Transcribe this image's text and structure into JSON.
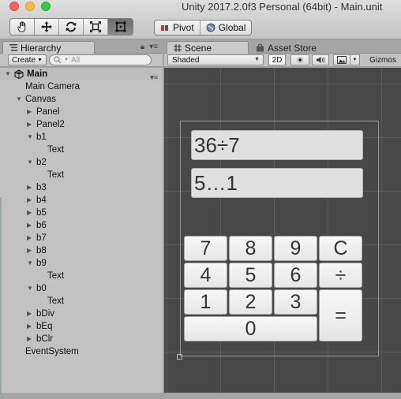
{
  "window": {
    "title": "Unity 2017.2.0f3 Personal (64bit) - Main.unit"
  },
  "toolbar": {
    "tools": [
      {
        "name": "hand-tool",
        "icon": "hand-icon"
      },
      {
        "name": "move-tool",
        "icon": "move-arrows-icon"
      },
      {
        "name": "rotate-tool",
        "icon": "rotate-icon"
      },
      {
        "name": "scale-tool",
        "icon": "scale-icon"
      },
      {
        "name": "rect-tool",
        "icon": "rect-transform-icon",
        "active": true
      }
    ],
    "pivot_label": "Pivot",
    "global_label": "Global"
  },
  "hierarchy": {
    "tab_label": "Hierarchy",
    "create_label": "Create",
    "search_placeholder": "All",
    "scene_name": "Main",
    "items": [
      {
        "label": "Main Camera",
        "depth": 1,
        "arrow": ""
      },
      {
        "label": "Canvas",
        "depth": 1,
        "arrow": "down"
      },
      {
        "label": "Panel",
        "depth": 2,
        "arrow": "right"
      },
      {
        "label": "Panel2",
        "depth": 2,
        "arrow": "right"
      },
      {
        "label": "b1",
        "depth": 2,
        "arrow": "down"
      },
      {
        "label": "Text",
        "depth": 3,
        "arrow": ""
      },
      {
        "label": "b2",
        "depth": 2,
        "arrow": "down"
      },
      {
        "label": "Text",
        "depth": 3,
        "arrow": ""
      },
      {
        "label": "b3",
        "depth": 2,
        "arrow": "right"
      },
      {
        "label": "b4",
        "depth": 2,
        "arrow": "right"
      },
      {
        "label": "b5",
        "depth": 2,
        "arrow": "right"
      },
      {
        "label": "b6",
        "depth": 2,
        "arrow": "right"
      },
      {
        "label": "b7",
        "depth": 2,
        "arrow": "right"
      },
      {
        "label": "b8",
        "depth": 2,
        "arrow": "right"
      },
      {
        "label": "b9",
        "depth": 2,
        "arrow": "down"
      },
      {
        "label": "Text",
        "depth": 3,
        "arrow": ""
      },
      {
        "label": "b0",
        "depth": 2,
        "arrow": "down"
      },
      {
        "label": "Text",
        "depth": 3,
        "arrow": ""
      },
      {
        "label": "bDiv",
        "depth": 2,
        "arrow": "right"
      },
      {
        "label": "bEq",
        "depth": 2,
        "arrow": "right"
      },
      {
        "label": "bClr",
        "depth": 2,
        "arrow": "right"
      },
      {
        "label": "EventSystem",
        "depth": 1,
        "arrow": ""
      }
    ]
  },
  "scene": {
    "tab_label": "Scene",
    "asset_store_label": "Asset Store",
    "shading_mode": "Shaded",
    "mode_2d_label": "2D",
    "gizmos_label": "Gizmos",
    "display_line1": "36÷7",
    "display_line2": "5…1",
    "keys": [
      "7",
      "8",
      "9",
      "C",
      "4",
      "5",
      "6",
      "÷",
      "1",
      "2",
      "3",
      "=",
      "0"
    ]
  }
}
